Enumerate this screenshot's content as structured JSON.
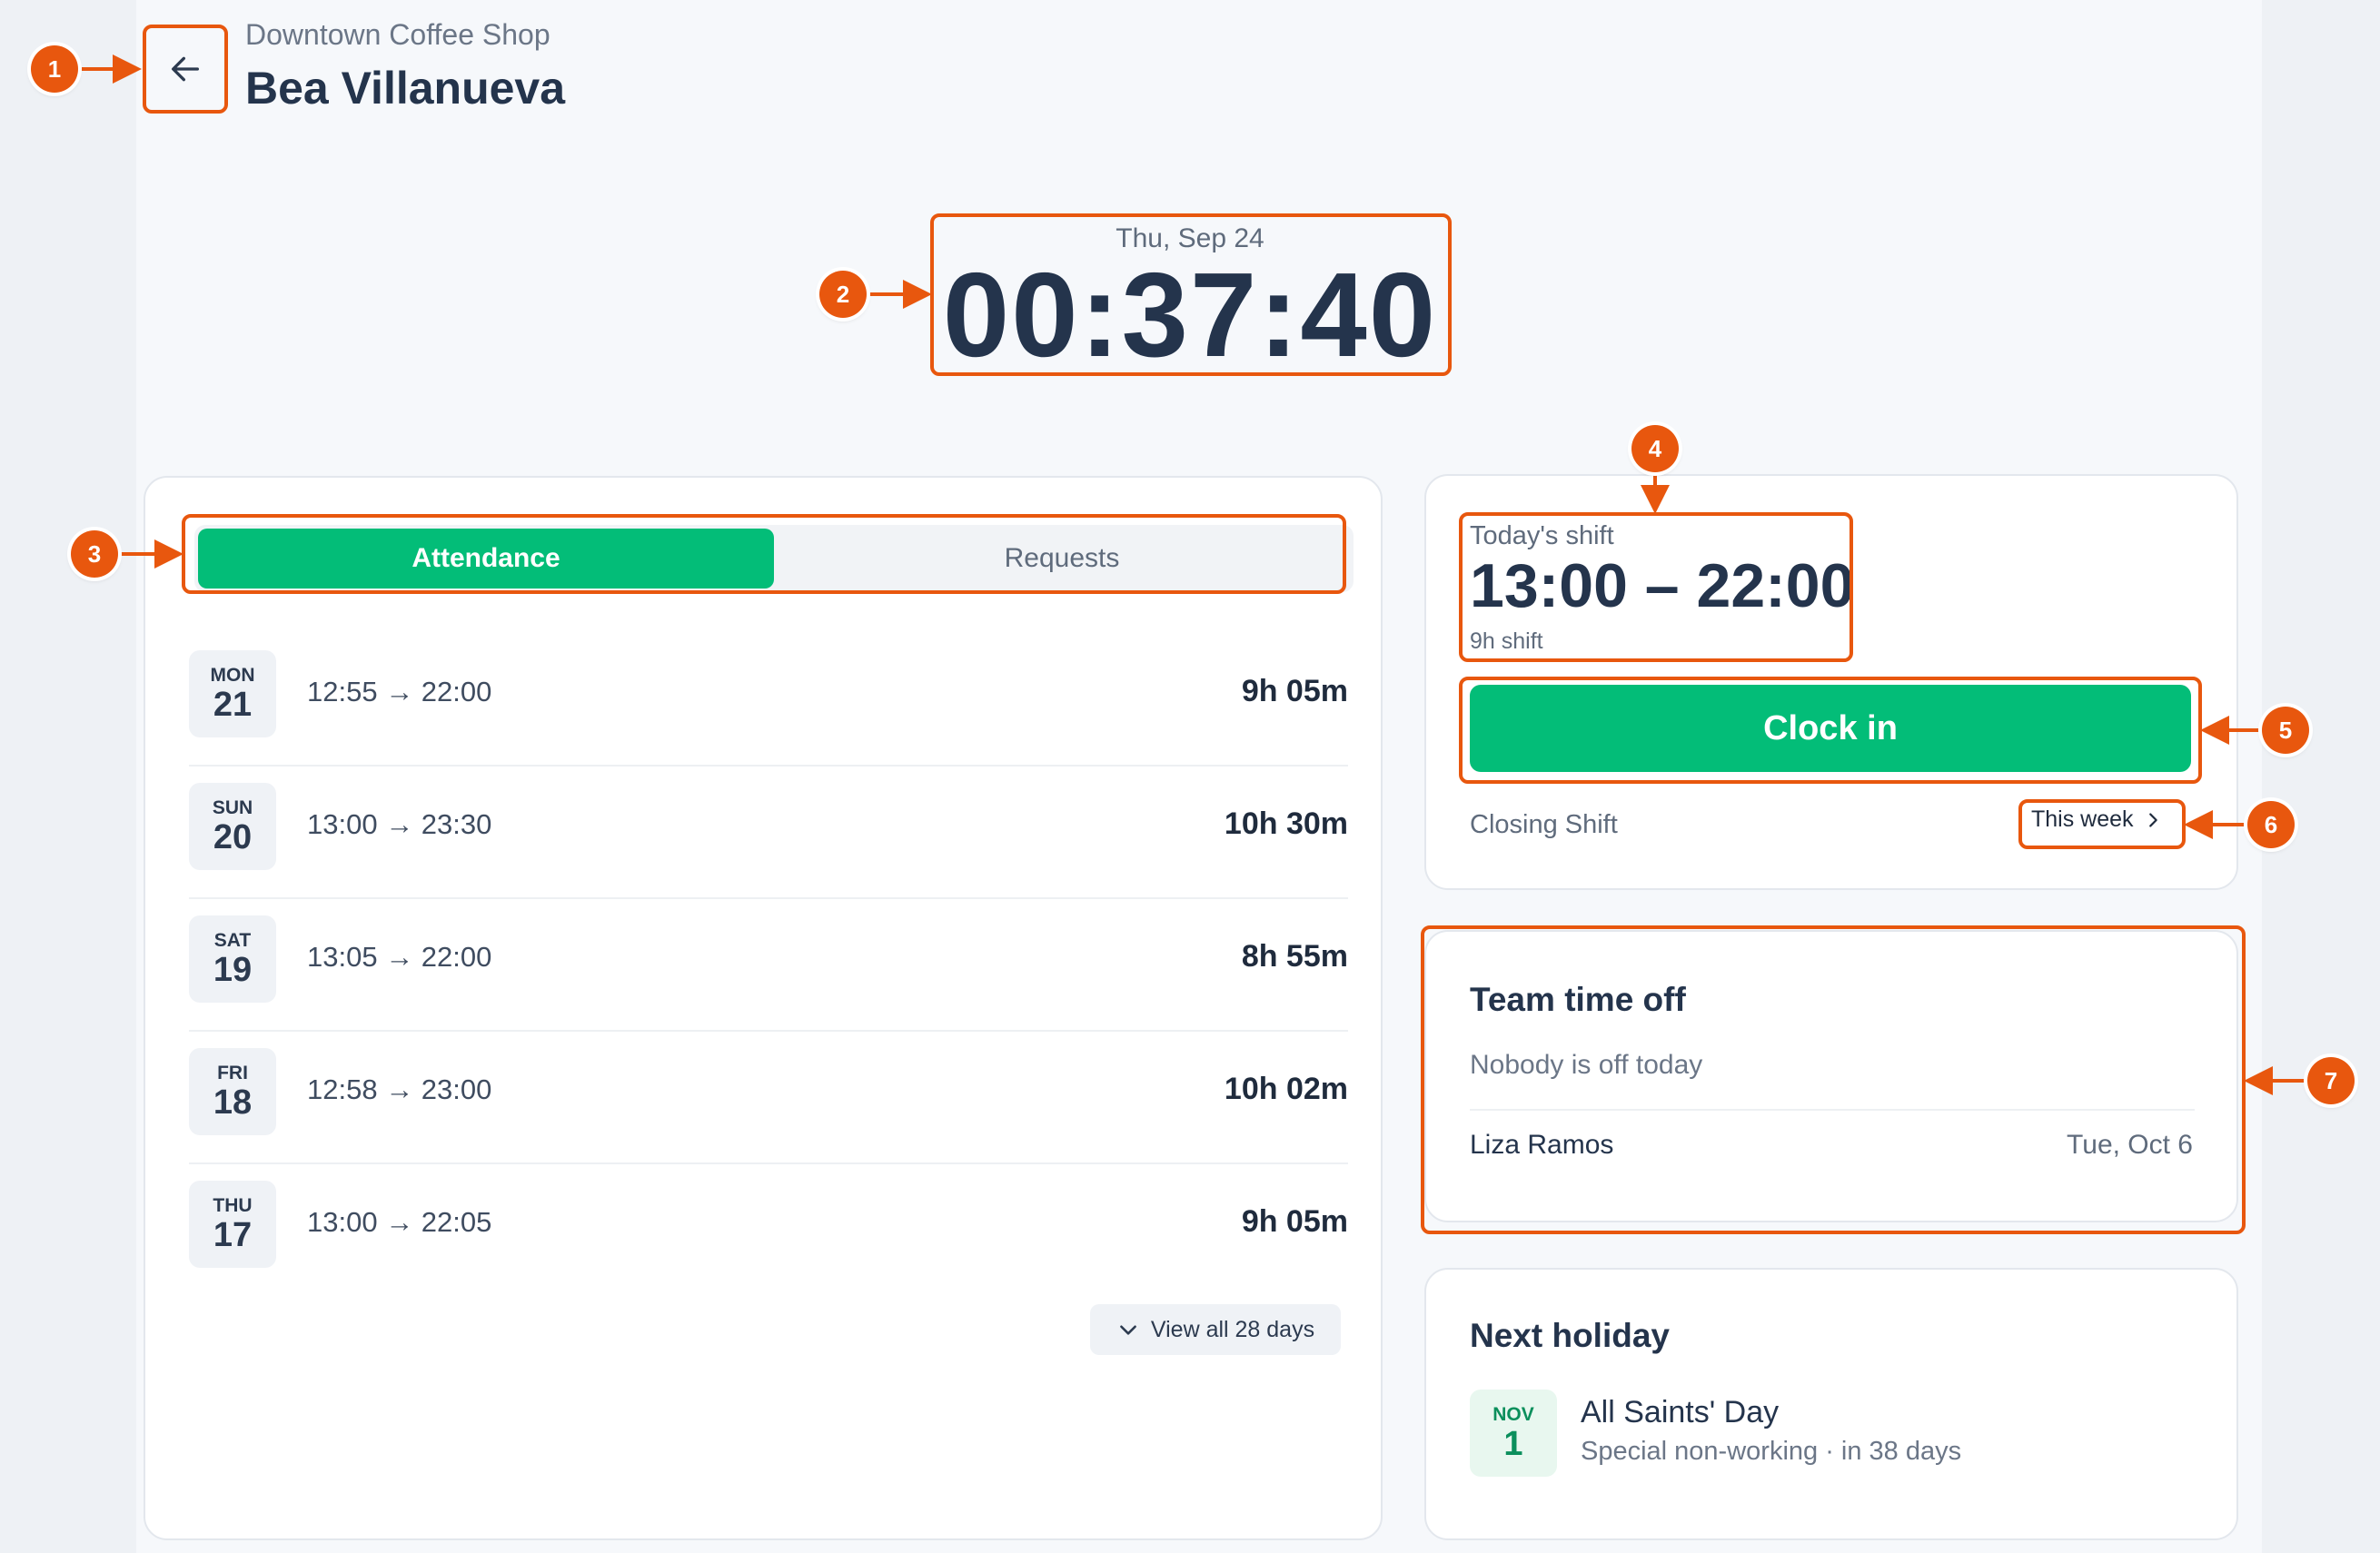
{
  "header": {
    "store_name": "Downtown Coffee Shop",
    "employee_name": "Bea Villanueva",
    "back_icon": "arrow-left-icon"
  },
  "clock": {
    "date": "Thu, Sep 24",
    "time": "00:37:40"
  },
  "tabs": [
    {
      "label": "Attendance",
      "active": true
    },
    {
      "label": "Requests",
      "active": false
    }
  ],
  "attendance": [
    {
      "dow": "MON",
      "day": "21",
      "range": "12:55 → 22:00",
      "total": "9h 05m"
    },
    {
      "dow": "SUN",
      "day": "20",
      "range": "13:00 → 23:30",
      "total": "10h 30m"
    },
    {
      "dow": "SAT",
      "day": "19",
      "range": "13:05 → 22:00",
      "total": "8h 55m"
    },
    {
      "dow": "FRI",
      "day": "18",
      "range": "12:58 → 23:00",
      "total": "10h 02m"
    },
    {
      "dow": "THU",
      "day": "17",
      "range": "13:00 → 22:05",
      "total": "9h 05m"
    }
  ],
  "view_all": "View all 28 days",
  "shift": {
    "label": "Today's shift",
    "time": "13:00 – 22:00",
    "duration": "9h shift",
    "clock_in": "Clock in",
    "name": "Closing Shift",
    "period": "This week"
  },
  "team_time_off": {
    "title": "Team time off",
    "subtitle": "Nobody is off today",
    "entries": [
      {
        "name": "Liza Ramos",
        "date": "Tue, Oct 6"
      }
    ]
  },
  "holiday": {
    "title": "Next holiday",
    "month": "NOV",
    "day": "1",
    "name": "All Saints' Day",
    "meta": "Special non-working · in 38 days"
  },
  "annotations": [
    "1",
    "2",
    "3",
    "4",
    "5",
    "6",
    "7"
  ],
  "colors": {
    "accent": "#03bd78",
    "annotation": "#e8570e",
    "text": "#24344c"
  }
}
